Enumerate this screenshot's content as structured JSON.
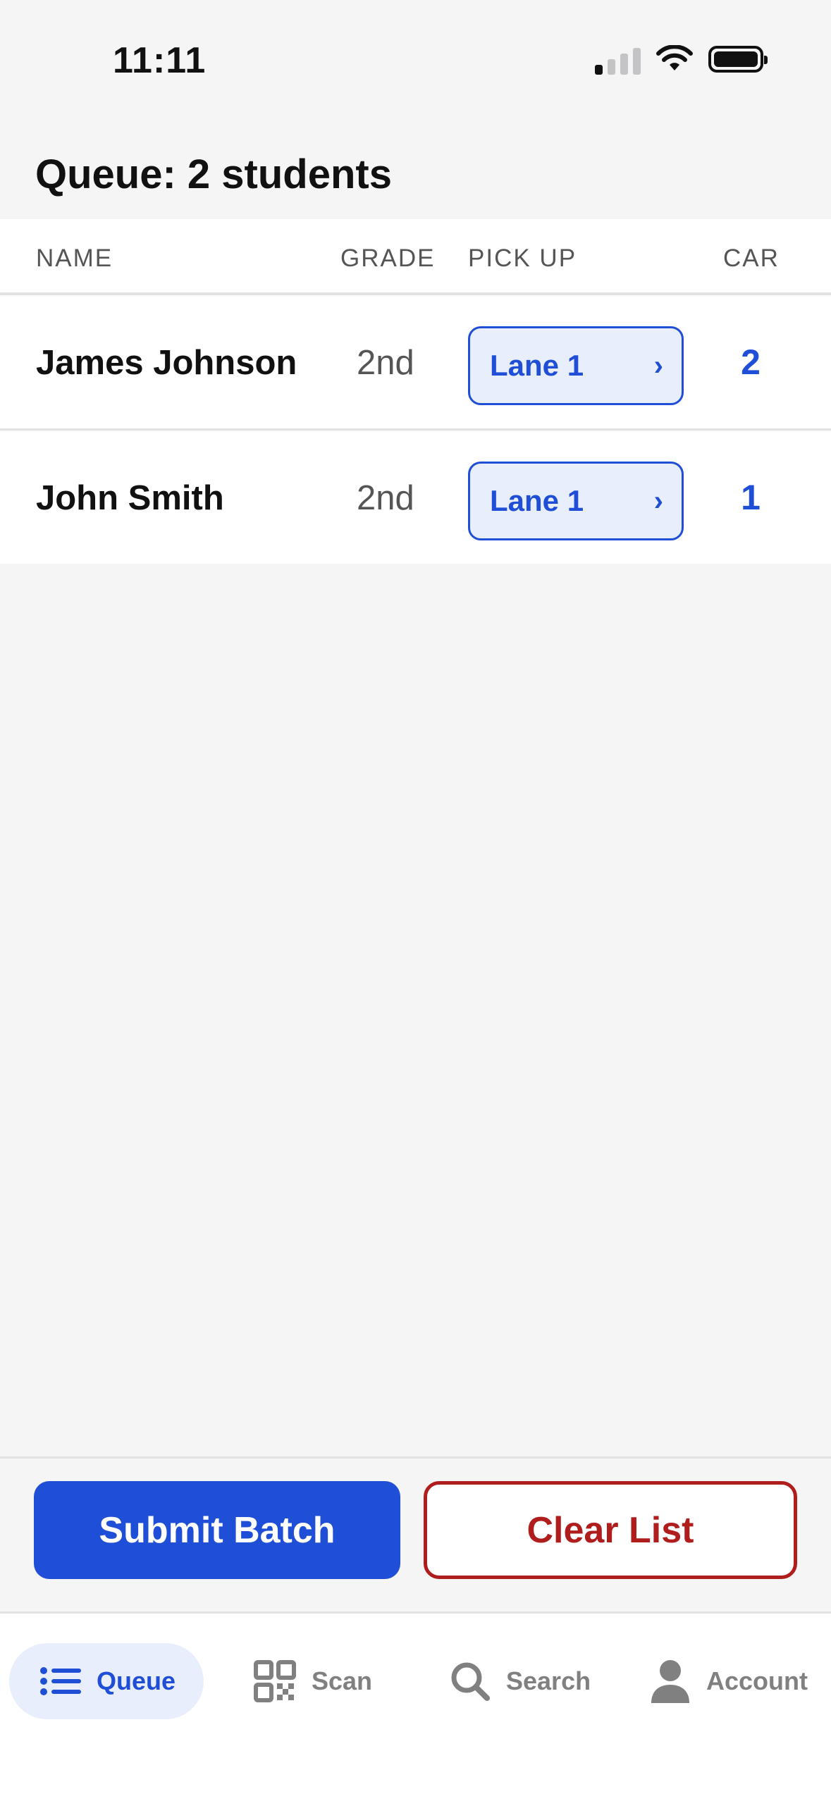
{
  "status_bar": {
    "time": "11:11",
    "signal_bars_on": 1,
    "signal_bars_total": 4
  },
  "page_title": "Queue: 2 students",
  "table": {
    "columns": [
      "NAME",
      "GRADE",
      "PICK UP",
      "CAR"
    ],
    "rows": [
      {
        "name": "James Johnson",
        "grade": "2nd",
        "pickup": "Lane 1",
        "car": "2"
      },
      {
        "name": "John Smith",
        "grade": "2nd",
        "pickup": "Lane 1",
        "car": "1"
      }
    ]
  },
  "actions": {
    "submit_label": "Submit Batch",
    "clear_label": "Clear List"
  },
  "tabs": [
    {
      "label": "Queue",
      "icon": "list-icon",
      "active": true
    },
    {
      "label": "Scan",
      "icon": "qr-code-icon",
      "active": false
    },
    {
      "label": "Search",
      "icon": "search-icon",
      "active": false
    },
    {
      "label": "Account",
      "icon": "person-icon",
      "active": false
    }
  ],
  "colors": {
    "accent": "#1f4fd6",
    "danger": "#b01d1d",
    "background": "#f5f5f6",
    "accent_tint": "#e8eefb"
  }
}
